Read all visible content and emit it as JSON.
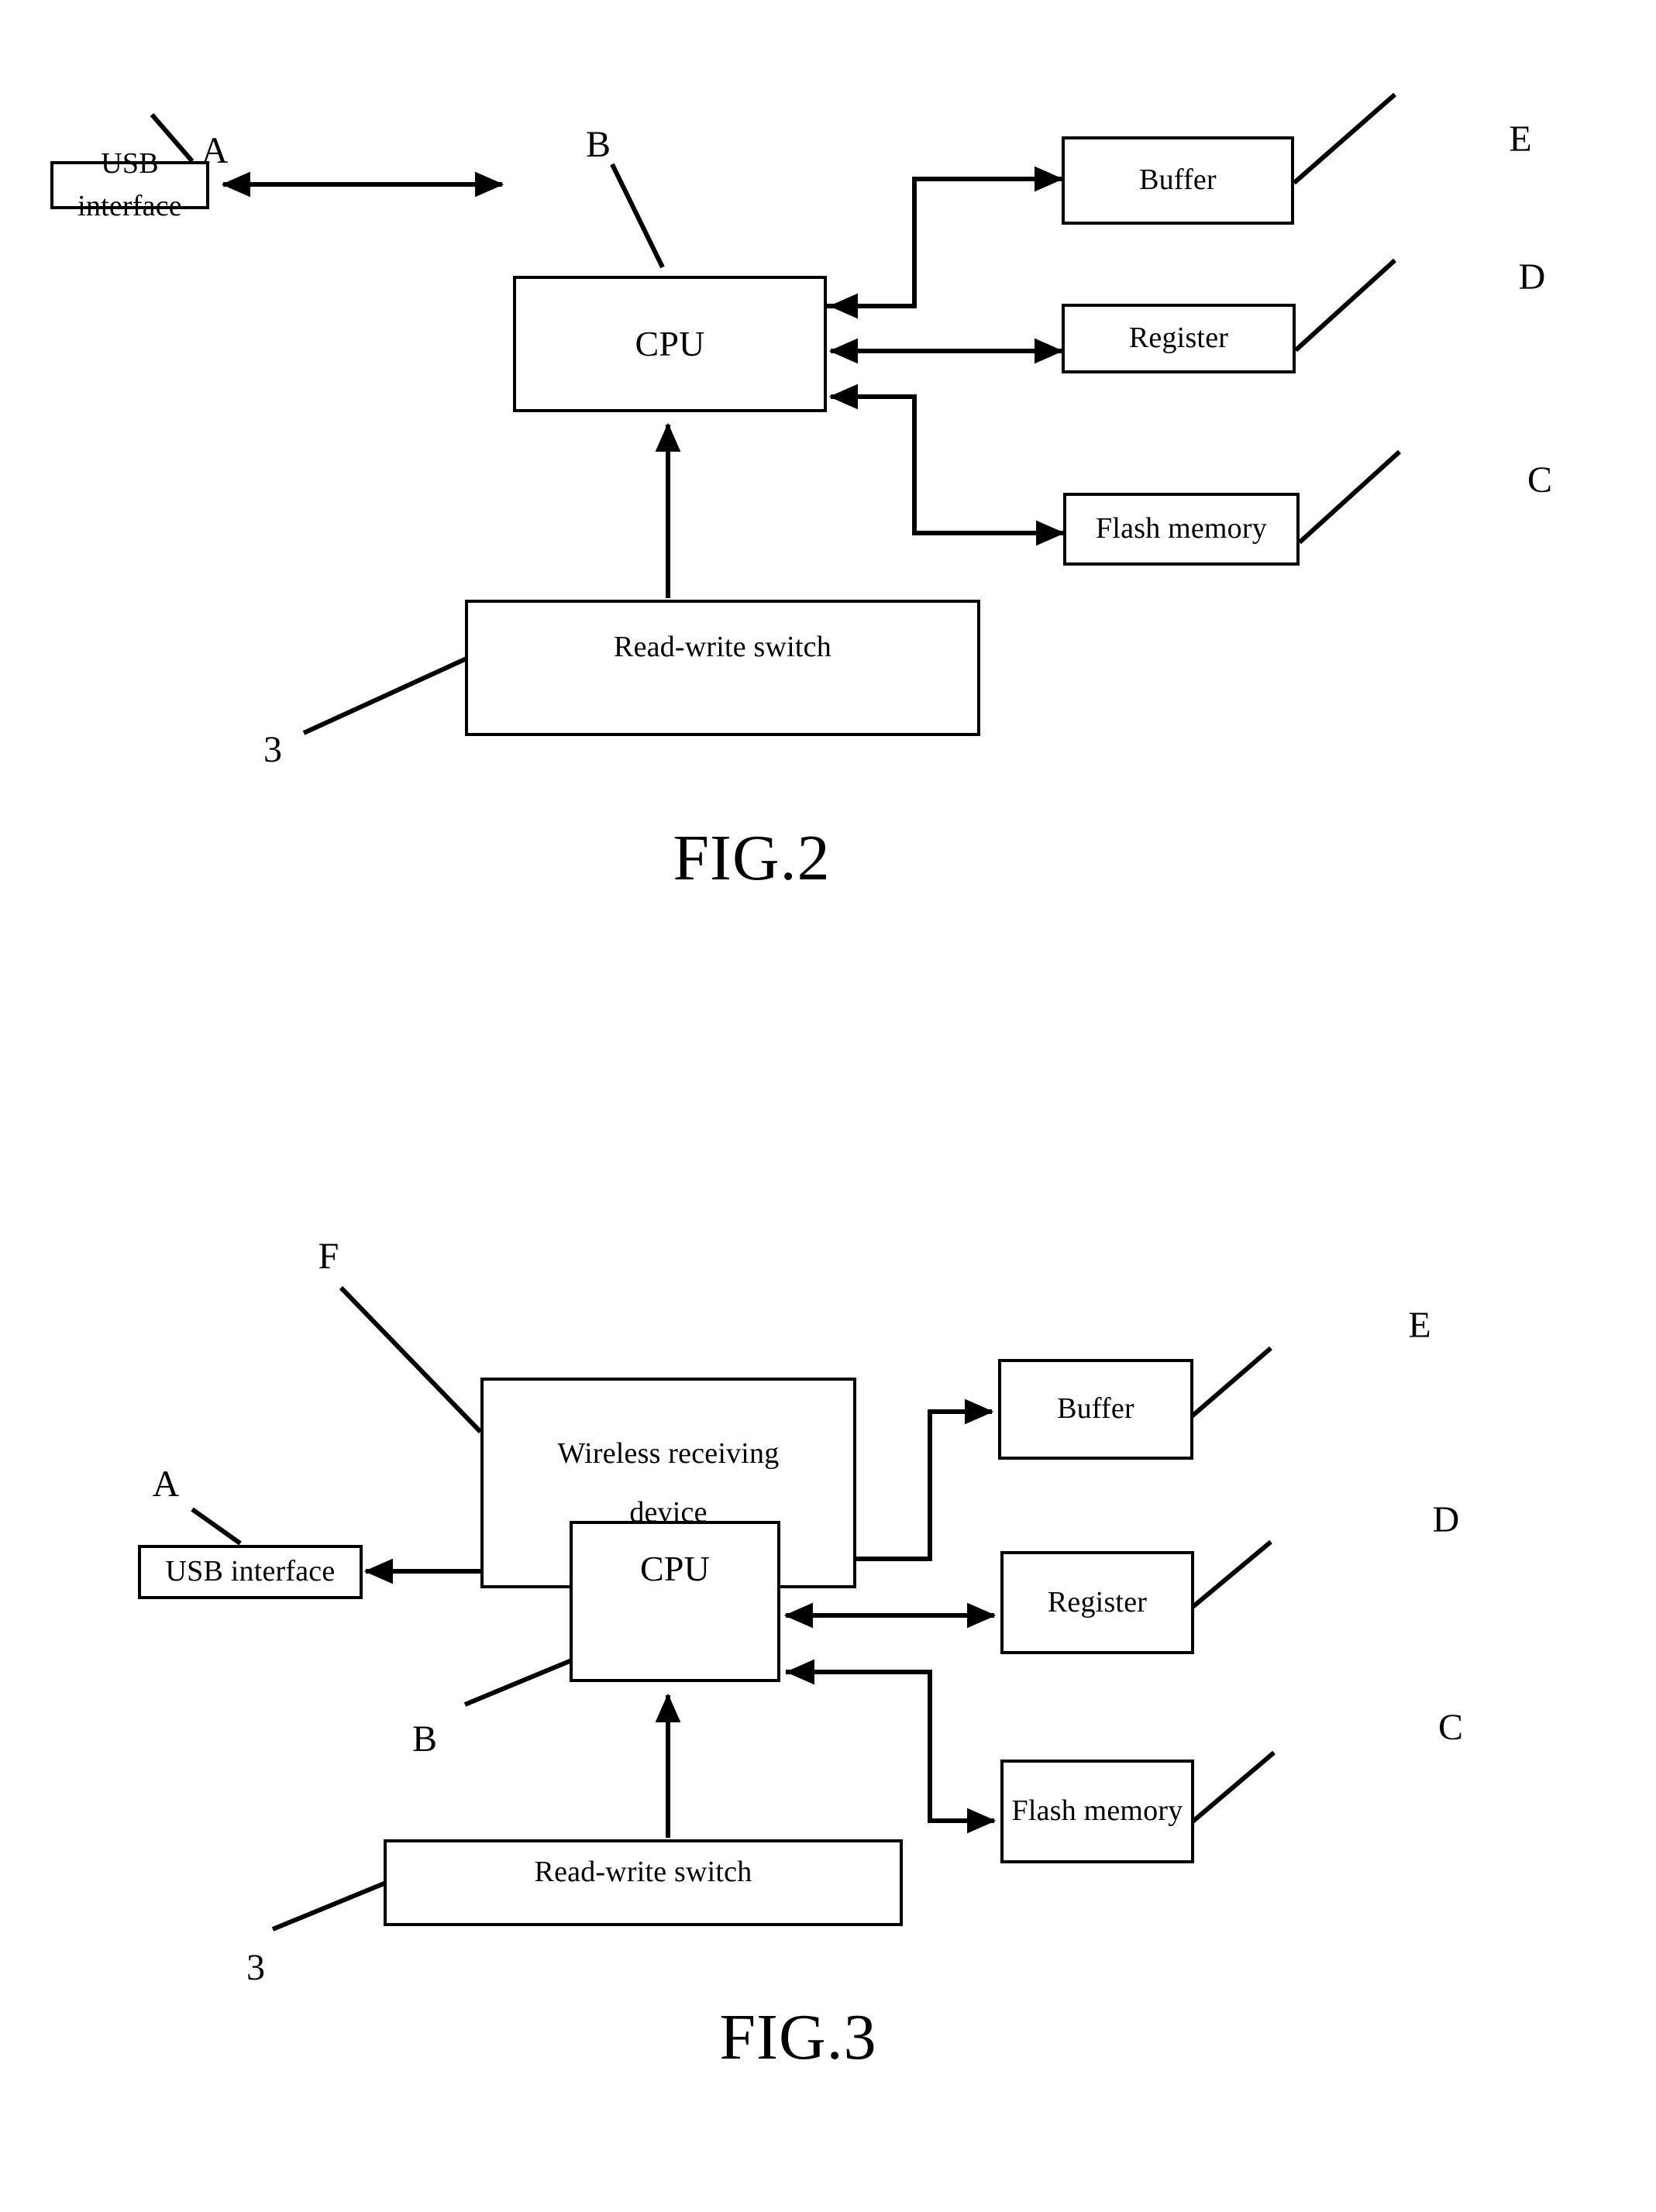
{
  "document": {
    "type": "patent-drawing-sheet",
    "background_color": "#ffffff",
    "line_color": "#000000"
  },
  "figures": [
    {
      "id": "fig2",
      "caption": "FIG.2",
      "nodes": [
        {
          "key": "usb_interface",
          "label": "USB interface"
        },
        {
          "key": "cpu",
          "label": "CPU"
        },
        {
          "key": "buffer",
          "label": "Buffer"
        },
        {
          "key": "register",
          "label": "Register"
        },
        {
          "key": "flash_memory",
          "label": "Flash memory"
        },
        {
          "key": "read_write_switch",
          "label": "Read-write switch"
        }
      ],
      "reference_labels": [
        {
          "key": "a",
          "text": "A",
          "points_to": "usb_interface"
        },
        {
          "key": "b",
          "text": "B",
          "points_to": "cpu"
        },
        {
          "key": "c",
          "text": "C",
          "points_to": "flash_memory"
        },
        {
          "key": "d",
          "text": "D",
          "points_to": "register"
        },
        {
          "key": "e",
          "text": "E",
          "points_to": "buffer"
        },
        {
          "key": "three",
          "text": "3",
          "points_to": "read_write_switch"
        }
      ]
    },
    {
      "id": "fig3",
      "caption": "FIG.3",
      "nodes": [
        {
          "key": "wireless_receiving_device",
          "label": "Wireless receiving\ndevice"
        },
        {
          "key": "usb_interface",
          "label": "USB interface"
        },
        {
          "key": "cpu",
          "label": "CPU"
        },
        {
          "key": "buffer",
          "label": "Buffer"
        },
        {
          "key": "register",
          "label": "Register"
        },
        {
          "key": "flash_memory",
          "label": "Flash memory"
        },
        {
          "key": "read_write_switch",
          "label": "Read-write switch"
        }
      ],
      "reference_labels": [
        {
          "key": "f",
          "text": "F",
          "points_to": "wireless_receiving_device"
        },
        {
          "key": "a",
          "text": "A",
          "points_to": "usb_interface"
        },
        {
          "key": "b",
          "text": "B",
          "points_to": "cpu"
        },
        {
          "key": "c",
          "text": "C",
          "points_to": "flash_memory"
        },
        {
          "key": "d",
          "text": "D",
          "points_to": "register"
        },
        {
          "key": "e",
          "text": "E",
          "points_to": "buffer"
        },
        {
          "key": "three",
          "text": "3",
          "points_to": "read_write_switch"
        }
      ]
    }
  ]
}
